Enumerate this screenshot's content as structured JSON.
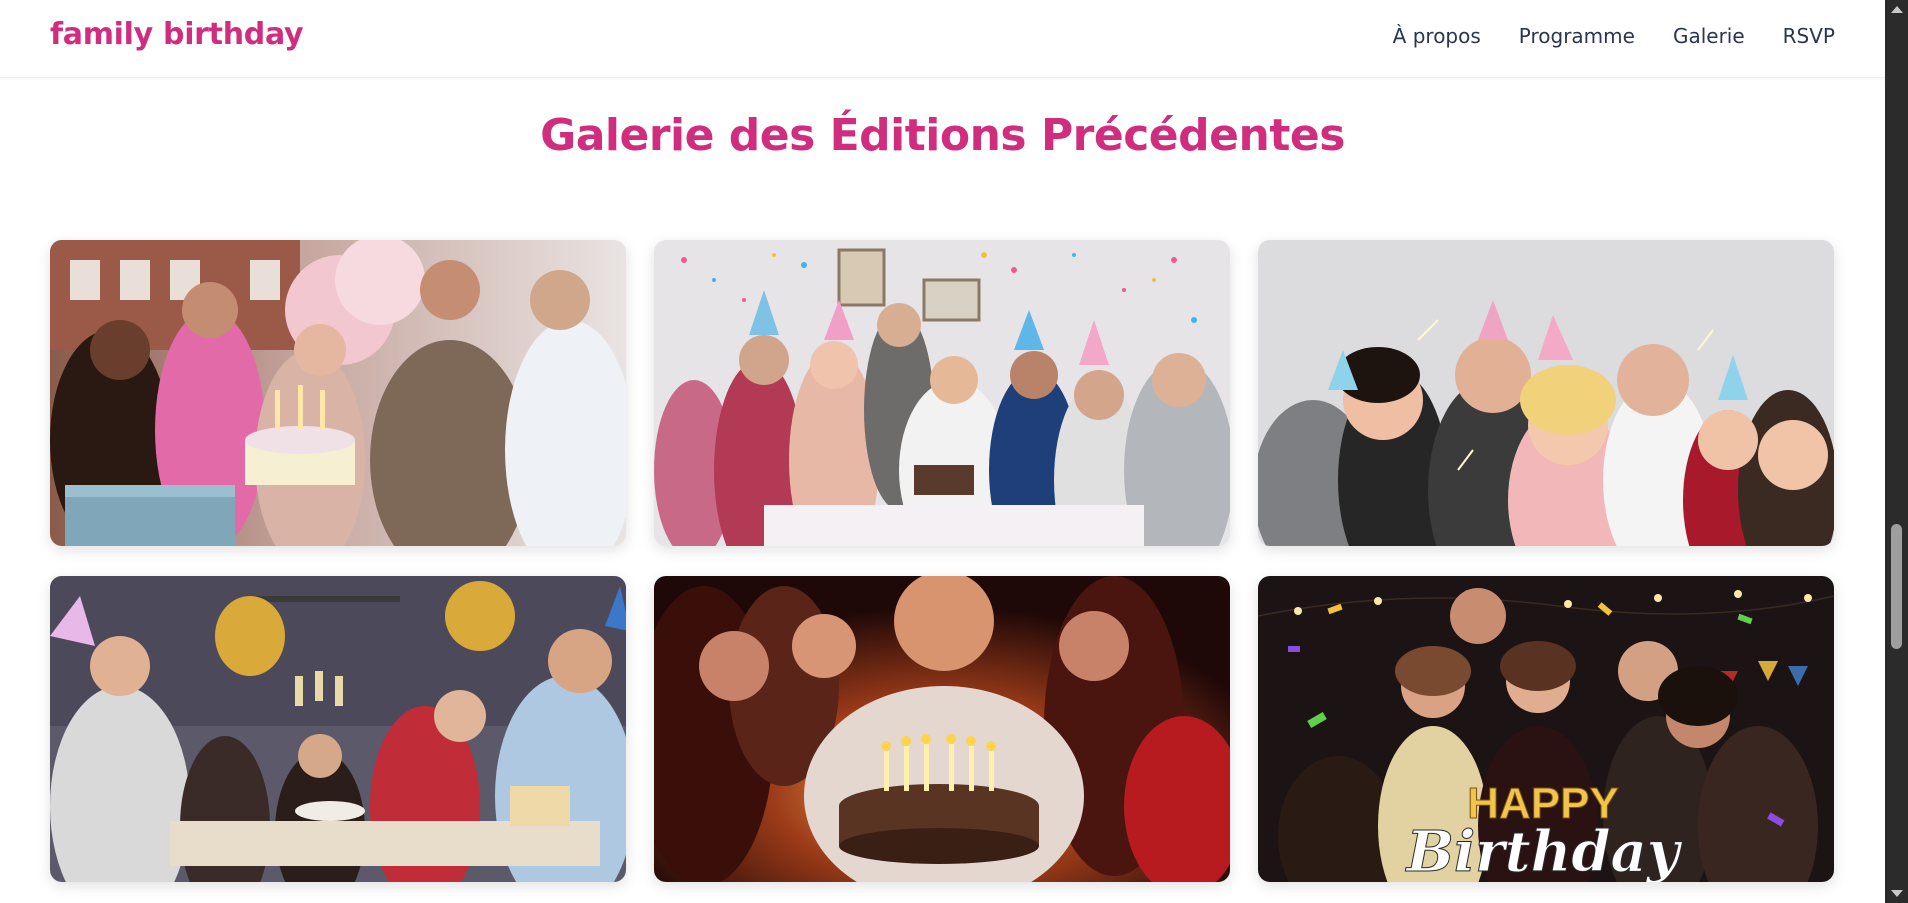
{
  "header": {
    "brand": "family birthday",
    "nav": [
      "À propos",
      "Programme",
      "Galerie",
      "RSVP"
    ]
  },
  "gallery": {
    "title": "Galerie des Éditions Précédentes",
    "photos": [
      {
        "name": "birthday-cake-friends-photo"
      },
      {
        "name": "confetti-party-table-photo"
      },
      {
        "name": "sparklers-party-hats-photo"
      },
      {
        "name": "champagne-toast-photo"
      },
      {
        "name": "candles-cake-night-photo"
      },
      {
        "name": "happy-birthday-confetti-photo",
        "overlay_top": "HAPPY",
        "overlay_bottom": "Birthday"
      }
    ]
  },
  "colors": {
    "brand": "#d12d7f",
    "nav_text": "#2b3553"
  }
}
